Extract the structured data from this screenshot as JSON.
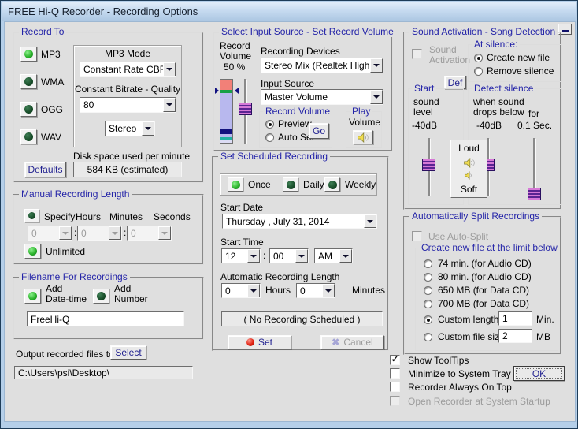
{
  "window": {
    "title": "FREE Hi-Q Recorder - Recording Options"
  },
  "record_to": {
    "title": "Record To",
    "formats": [
      {
        "label": "MP3",
        "on": true
      },
      {
        "label": "WMA",
        "on": false
      },
      {
        "label": "OGG",
        "on": false
      },
      {
        "label": "WAV",
        "on": false
      }
    ],
    "mp3_mode": {
      "label": "MP3 Mode",
      "value": "Constant Rate CBR"
    },
    "bitrate": {
      "label": "Constant Bitrate - Quality",
      "value": "80"
    },
    "channels": {
      "value": "Stereo"
    },
    "disk_space": {
      "label": "Disk space used per minute",
      "value": "584  KB (estimated)"
    },
    "defaults_button": "Defaults"
  },
  "manual_length": {
    "title": "Manual Recording Length",
    "specify_label": "Specify",
    "hours_label": "Hours",
    "minutes_label": "Minutes",
    "seconds_label": "Seconds",
    "hours": "0",
    "minutes": "0",
    "seconds": "0",
    "colon": ":",
    "unlimited_label": "Unlimited"
  },
  "filename": {
    "title": "Filename For Recordings",
    "add_datetime": {
      "line1": "Add",
      "line2": "Date-time",
      "on": true
    },
    "add_number": {
      "line1": "Add",
      "line2": "Number",
      "on": false
    },
    "value": "FreeHi-Q"
  },
  "output": {
    "label": "Output recorded files to",
    "select_button": "Select",
    "path": "C:\\Users\\psi\\Desktop\\"
  },
  "input_source": {
    "title": "Select Input Source - Set Record Volume",
    "record_volume_line1": "Record",
    "record_volume_line2": "Volume",
    "record_volume_line3": "50 %",
    "recording_devices": {
      "label": "Recording Devices",
      "value": "Stereo Mix (Realtek High De"
    },
    "source": {
      "label": "Input Source",
      "value": "Master Volume"
    },
    "record_volume_group": {
      "title": "Record Volume",
      "preview_label": "Preview",
      "autoset_label": "Auto Set",
      "selected": "Preview",
      "go_button": "Go"
    },
    "play_volume_group": {
      "title": "Play",
      "line2": "Volume"
    }
  },
  "schedule": {
    "title": "Set Scheduled Recording",
    "modes": [
      {
        "label": "Once",
        "on": true
      },
      {
        "label": "Daily",
        "on": false
      },
      {
        "label": "Weekly",
        "on": false
      }
    ],
    "start_date": {
      "label": "Start Date",
      "value": " Thursday ,      July      31, 2014"
    },
    "start_time": {
      "label": "Start Time",
      "hour": "12",
      "minute": "00",
      "ampm": "AM",
      "colon": ":"
    },
    "auto_length": {
      "label": "Automatic Recording Length",
      "hours": "0",
      "hours_label": "Hours",
      "minutes": "0",
      "minutes_label": "Minutes"
    },
    "status": "( No Recording Scheduled )",
    "set_button": "Set",
    "cancel_button": "Cancel"
  },
  "sound_activation": {
    "title": "Sound Activation - Song Detection",
    "checkbox_line1": "Sound",
    "checkbox_line2": "Activation",
    "at_silence": {
      "title": "At silence:",
      "option1": "Create new file",
      "option2": "Remove silence",
      "selected": "Create new file"
    },
    "def_button": "Def",
    "start_level": {
      "title": "Start",
      "line1": "sound",
      "line2": "level",
      "value": "-40dB"
    },
    "detect": {
      "title": "Detect silence",
      "line1": "when sound",
      "line2": "drops below",
      "for_label": "for",
      "level": "-40dB",
      "duration": "0.1  Sec."
    },
    "loud_label": "Loud",
    "soft_label": "Soft"
  },
  "auto_split": {
    "title": "Automatically Split Recordings",
    "use_label": "Use Auto-Split",
    "limit_group": {
      "title": "Create new file at the limit below",
      "option1": "74 min. (for Audio CD)",
      "option2": "80 min. (for Audio CD)",
      "option3": "650 MB (for Data CD)",
      "option4": "700 MB (for Data CD)",
      "custom_length": {
        "label": "Custom length",
        "value": "1",
        "unit": "Min.",
        "selected": true
      },
      "custom_size": {
        "label": "Custom file size",
        "value": "2",
        "unit": "MB",
        "selected": false
      }
    }
  },
  "options": {
    "checkboxes": [
      {
        "label": "Show ToolTips",
        "checked": true,
        "enabled": true
      },
      {
        "label": "Minimize to System Tray",
        "checked": false,
        "enabled": true
      },
      {
        "label": "Recorder Always On Top",
        "checked": false,
        "enabled": true
      },
      {
        "label": "Open Recorder at System Startup",
        "checked": false,
        "enabled": false
      }
    ],
    "ok_button": "OK",
    "check_glyph": "✓"
  }
}
